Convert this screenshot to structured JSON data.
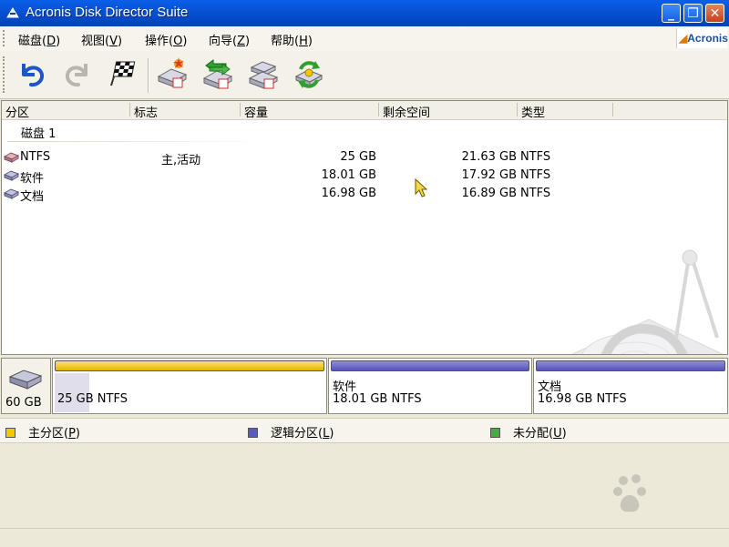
{
  "window": {
    "title": "Acronis Disk Director Suite",
    "controls": [
      "minimize-icon",
      "maximize-icon",
      "close-icon"
    ]
  },
  "menu": {
    "items": [
      {
        "label": "磁盘(D)",
        "key": "D"
      },
      {
        "label": "视图(V)",
        "key": "V"
      },
      {
        "label": "操作(O)",
        "key": "O"
      },
      {
        "label": "向导(Z)",
        "key": "Z"
      },
      {
        "label": "帮助(H)",
        "key": "H"
      }
    ],
    "logo_text": "Acronis"
  },
  "toolbar": {
    "buttons": [
      {
        "icon": "undo-icon",
        "enabled": true
      },
      {
        "icon": "redo-icon",
        "enabled": false
      },
      {
        "icon": "commit-flag-icon",
        "enabled": true
      },
      {
        "icon": "create-partition-icon",
        "enabled": true
      },
      {
        "icon": "copy-partition-icon",
        "enabled": true
      },
      {
        "icon": "move-partition-icon",
        "enabled": true
      },
      {
        "icon": "recovery-icon",
        "enabled": true
      }
    ]
  },
  "table": {
    "columns": [
      "分区",
      "标志",
      "容量",
      "剩余空间",
      "类型"
    ],
    "disk_label": "磁盘 1",
    "rows": [
      {
        "name": "NTFS",
        "flags": "主,活动",
        "capacity": "25 GB",
        "free": "21.63 GB",
        "type": "NTFS"
      },
      {
        "name": "软件",
        "flags": "",
        "capacity": "18.01 GB",
        "free": "17.92 GB",
        "type": "NTFS"
      },
      {
        "name": "文档",
        "flags": "",
        "capacity": "16.98 GB",
        "free": "16.89 GB",
        "type": "NTFS"
      }
    ]
  },
  "diskmap": {
    "disk_size": "60 GB",
    "partitions": [
      {
        "name": "",
        "info": "25 GB  NTFS",
        "kind": "primary"
      },
      {
        "name": "软件",
        "info": "18.01 GB  NTFS",
        "kind": "logical"
      },
      {
        "name": "文档",
        "info": "16.98 GB  NTFS",
        "kind": "logical"
      }
    ]
  },
  "legend": {
    "items": [
      {
        "label": "主分区(P)",
        "color": "#f2c800"
      },
      {
        "label": "逻辑分区(L)",
        "color": "#5b59c2"
      },
      {
        "label": "未分配(U)",
        "color": "#3fb13a"
      }
    ]
  },
  "colors": {
    "titlebar": "#0653d6",
    "primary": "#f2c800",
    "logical": "#5b59c2",
    "unallocated": "#3fb13a"
  }
}
